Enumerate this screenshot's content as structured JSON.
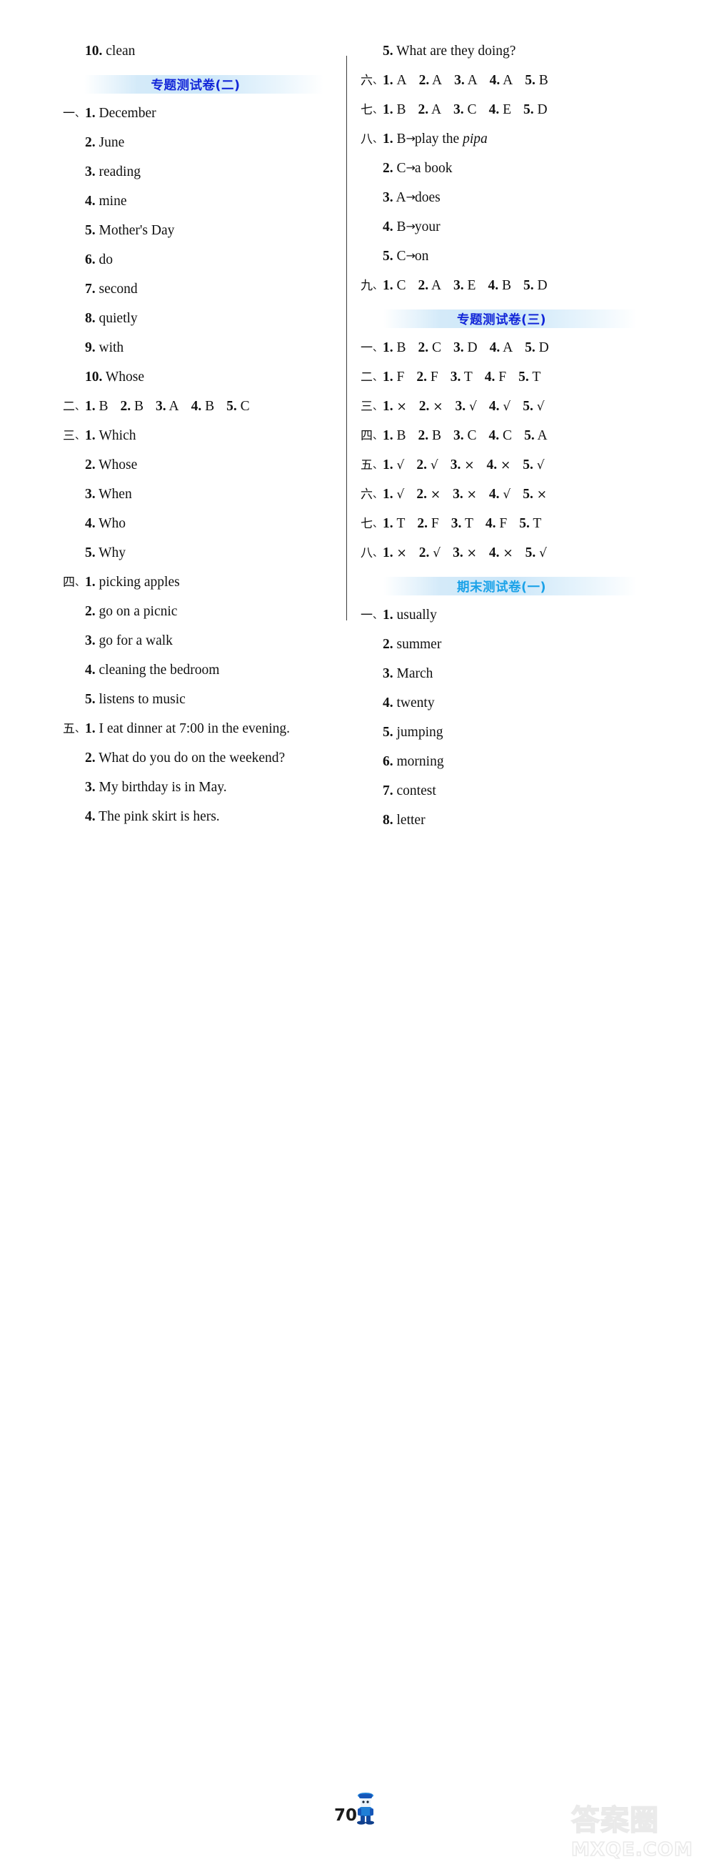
{
  "page": {
    "number": "70",
    "watermark_cn": "答案圈",
    "watermark_en": "MXQE.COM"
  },
  "colors": {
    "banner_dark_blue": "#1226d8",
    "banner_light_blue": "#1ba2e8",
    "band_fill": "#c6e4f8",
    "text": "#111111"
  },
  "left_column": {
    "blocks": [
      {
        "type": "items",
        "items": [
          {
            "indent": true,
            "num": "10.",
            "text": "clean"
          }
        ]
      },
      {
        "type": "banner",
        "style": "dark",
        "title": "专题测试卷(二)"
      },
      {
        "type": "items",
        "items": [
          {
            "indent": false,
            "cn": "一",
            "num": "1.",
            "text": "December"
          },
          {
            "indent": true,
            "num": "2.",
            "text": "June"
          },
          {
            "indent": true,
            "num": "3.",
            "text": "reading"
          },
          {
            "indent": true,
            "num": "4.",
            "text": "mine"
          },
          {
            "indent": true,
            "num": "5.",
            "text": "Mother's Day"
          },
          {
            "indent": true,
            "num": "6.",
            "text": "do"
          },
          {
            "indent": true,
            "num": "7.",
            "text": "second"
          },
          {
            "indent": true,
            "num": "8.",
            "text": "quietly"
          },
          {
            "indent": true,
            "num": "9.",
            "text": "with"
          },
          {
            "indent": true,
            "num": "10.",
            "text": "Whose"
          }
        ]
      },
      {
        "type": "row",
        "cn": "二",
        "tokens": [
          {
            "num": "1.",
            "text": "B"
          },
          {
            "num": "2.",
            "text": "B"
          },
          {
            "num": "3.",
            "text": "A"
          },
          {
            "num": "4.",
            "text": "B"
          },
          {
            "num": "5.",
            "text": "C"
          }
        ]
      },
      {
        "type": "items",
        "items": [
          {
            "indent": false,
            "cn": "三",
            "num": "1.",
            "text": "Which"
          },
          {
            "indent": true,
            "num": "2.",
            "text": "Whose"
          },
          {
            "indent": true,
            "num": "3.",
            "text": "When"
          },
          {
            "indent": true,
            "num": "4.",
            "text": "Who"
          },
          {
            "indent": true,
            "num": "5.",
            "text": "Why"
          }
        ]
      },
      {
        "type": "items",
        "items": [
          {
            "indent": false,
            "cn": "四",
            "num": "1.",
            "text": "picking apples"
          },
          {
            "indent": true,
            "num": "2.",
            "text": "go on a picnic"
          },
          {
            "indent": true,
            "num": "3.",
            "text": "go for a walk"
          },
          {
            "indent": true,
            "num": "4.",
            "text": "cleaning the bedroom"
          },
          {
            "indent": true,
            "num": "5.",
            "text": "listens to music"
          }
        ]
      },
      {
        "type": "items",
        "items": [
          {
            "indent": false,
            "cn": "五",
            "num": "1.",
            "text": "I eat dinner at 7:00 in the evening."
          },
          {
            "indent": true,
            "num": "2.",
            "text": "What do you do on the weekend?"
          },
          {
            "indent": true,
            "num": "3.",
            "text": "My birthday is in May."
          },
          {
            "indent": true,
            "num": "4.",
            "text": "The pink skirt is hers."
          }
        ]
      }
    ]
  },
  "right_column": {
    "blocks": [
      {
        "type": "items",
        "items": [
          {
            "indent": true,
            "num": "5.",
            "text": "What are they doing?"
          }
        ]
      },
      {
        "type": "row",
        "cn": "六",
        "tokens": [
          {
            "num": "1.",
            "text": "A"
          },
          {
            "num": "2.",
            "text": "A"
          },
          {
            "num": "3.",
            "text": "A"
          },
          {
            "num": "4.",
            "text": "A"
          },
          {
            "num": "5.",
            "text": "B"
          }
        ]
      },
      {
        "type": "row",
        "cn": "七",
        "tokens": [
          {
            "num": "1.",
            "text": "B"
          },
          {
            "num": "2.",
            "text": "A"
          },
          {
            "num": "3.",
            "text": "C"
          },
          {
            "num": "4.",
            "text": "E"
          },
          {
            "num": "5.",
            "text": "D"
          }
        ]
      },
      {
        "type": "items",
        "items": [
          {
            "indent": false,
            "cn": "八",
            "num": "1.",
            "text": "B",
            "arrow": "→",
            "after": "play the ",
            "after_italic": "pipa"
          },
          {
            "indent": true,
            "num": "2.",
            "text": "C",
            "arrow": "→",
            "after": "a book"
          },
          {
            "indent": true,
            "num": "3.",
            "text": "A",
            "arrow": "→",
            "after": "does"
          },
          {
            "indent": true,
            "num": "4.",
            "text": "B",
            "arrow": "→",
            "after": "your"
          },
          {
            "indent": true,
            "num": "5.",
            "text": "C",
            "arrow": "→",
            "after": "on"
          }
        ]
      },
      {
        "type": "row",
        "cn": "九",
        "tokens": [
          {
            "num": "1.",
            "text": "C"
          },
          {
            "num": "2.",
            "text": "A"
          },
          {
            "num": "3.",
            "text": "E"
          },
          {
            "num": "4.",
            "text": "B"
          },
          {
            "num": "5.",
            "text": "D"
          }
        ]
      },
      {
        "type": "banner",
        "style": "dark",
        "title": "专题测试卷(三)"
      },
      {
        "type": "row",
        "cn": "一",
        "tokens": [
          {
            "num": "1.",
            "text": "B"
          },
          {
            "num": "2.",
            "text": "C"
          },
          {
            "num": "3.",
            "text": "D"
          },
          {
            "num": "4.",
            "text": "A"
          },
          {
            "num": "5.",
            "text": "D"
          }
        ]
      },
      {
        "type": "row",
        "cn": "二",
        "tokens": [
          {
            "num": "1.",
            "text": "F"
          },
          {
            "num": "2.",
            "text": "F"
          },
          {
            "num": "3.",
            "text": "T"
          },
          {
            "num": "4.",
            "text": "F"
          },
          {
            "num": "5.",
            "text": "T"
          }
        ]
      },
      {
        "type": "row",
        "cn": "三",
        "mark": true,
        "tokens": [
          {
            "num": "1.",
            "text": "×"
          },
          {
            "num": "2.",
            "text": "×"
          },
          {
            "num": "3.",
            "text": "√"
          },
          {
            "num": "4.",
            "text": "√"
          },
          {
            "num": "5.",
            "text": "√"
          }
        ]
      },
      {
        "type": "row",
        "cn": "四",
        "tokens": [
          {
            "num": "1.",
            "text": "B"
          },
          {
            "num": "2.",
            "text": "B"
          },
          {
            "num": "3.",
            "text": "C"
          },
          {
            "num": "4.",
            "text": "C"
          },
          {
            "num": "5.",
            "text": "A"
          }
        ]
      },
      {
        "type": "row",
        "cn": "五",
        "mark": true,
        "tokens": [
          {
            "num": "1.",
            "text": "√"
          },
          {
            "num": "2.",
            "text": "√"
          },
          {
            "num": "3.",
            "text": "×"
          },
          {
            "num": "4.",
            "text": "×"
          },
          {
            "num": "5.",
            "text": "√"
          }
        ]
      },
      {
        "type": "row",
        "cn": "六",
        "mark": true,
        "tokens": [
          {
            "num": "1.",
            "text": "√"
          },
          {
            "num": "2.",
            "text": "×"
          },
          {
            "num": "3.",
            "text": "×"
          },
          {
            "num": "4.",
            "text": "√"
          },
          {
            "num": "5.",
            "text": "×"
          }
        ]
      },
      {
        "type": "row",
        "cn": "七",
        "tokens": [
          {
            "num": "1.",
            "text": "T"
          },
          {
            "num": "2.",
            "text": "F"
          },
          {
            "num": "3.",
            "text": "T"
          },
          {
            "num": "4.",
            "text": "F"
          },
          {
            "num": "5.",
            "text": "T"
          }
        ]
      },
      {
        "type": "row",
        "cn": "八",
        "mark": true,
        "tokens": [
          {
            "num": "1.",
            "text": "×"
          },
          {
            "num": "2.",
            "text": "√"
          },
          {
            "num": "3.",
            "text": "×"
          },
          {
            "num": "4.",
            "text": "×"
          },
          {
            "num": "5.",
            "text": "√"
          }
        ]
      },
      {
        "type": "banner",
        "style": "light",
        "title": "期末测试卷(一)"
      },
      {
        "type": "items",
        "items": [
          {
            "indent": false,
            "cn": "一",
            "num": "1.",
            "text": "usually"
          },
          {
            "indent": true,
            "num": "2.",
            "text": "summer"
          },
          {
            "indent": true,
            "num": "3.",
            "text": "March"
          },
          {
            "indent": true,
            "num": "4.",
            "text": "twenty"
          },
          {
            "indent": true,
            "num": "5.",
            "text": "jumping"
          },
          {
            "indent": true,
            "num": "6.",
            "text": "morning"
          },
          {
            "indent": true,
            "num": "7.",
            "text": "contest"
          },
          {
            "indent": true,
            "num": "8.",
            "text": "letter"
          }
        ]
      }
    ]
  }
}
